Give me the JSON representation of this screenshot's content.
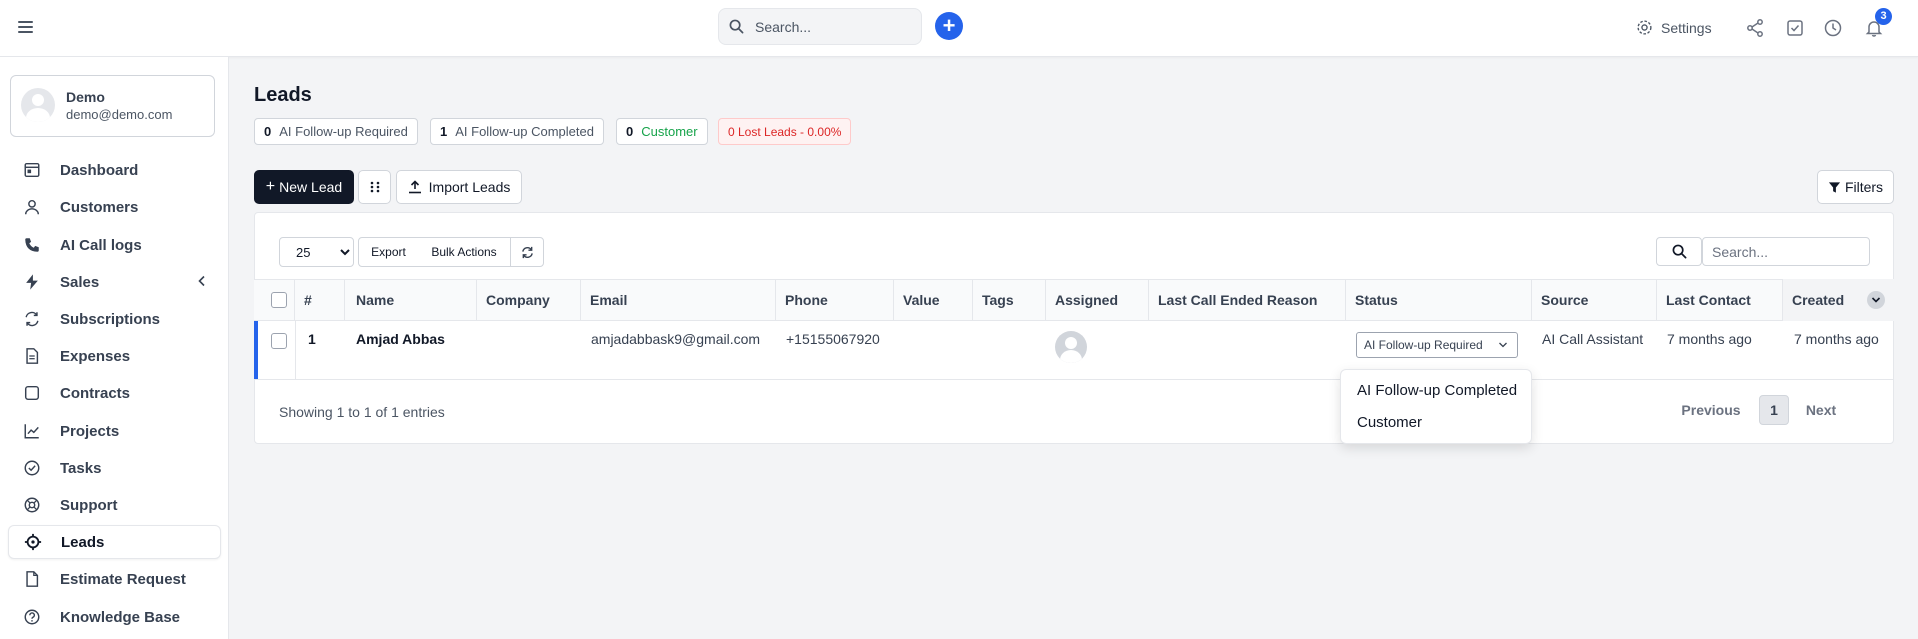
{
  "topbar": {
    "search_placeholder": "Search...",
    "settings_label": "Settings",
    "notifications_count": "3"
  },
  "profile": {
    "name": "Demo",
    "email": "demo@demo.com"
  },
  "sidebar": {
    "items": [
      {
        "label": "Dashboard",
        "icon": "dashboard-icon"
      },
      {
        "label": "Customers",
        "icon": "user-icon"
      },
      {
        "label": "AI Call logs",
        "icon": "phone-icon"
      },
      {
        "label": "Sales",
        "icon": "bolt-icon"
      },
      {
        "label": "Subscriptions",
        "icon": "refresh-icon"
      },
      {
        "label": "Expenses",
        "icon": "document-icon"
      },
      {
        "label": "Contracts",
        "icon": "square-icon"
      },
      {
        "label": "Projects",
        "icon": "chart-icon"
      },
      {
        "label": "Tasks",
        "icon": "check-circle-icon"
      },
      {
        "label": "Support",
        "icon": "lifebuoy-icon"
      },
      {
        "label": "Leads",
        "icon": "crosshair-icon"
      },
      {
        "label": "Estimate Request",
        "icon": "file-icon"
      },
      {
        "label": "Knowledge Base",
        "icon": "question-circle-icon"
      }
    ],
    "active": "Leads"
  },
  "page": {
    "title": "Leads",
    "chips": [
      {
        "count": "0",
        "label": "AI Follow-up Required"
      },
      {
        "count": "1",
        "label": "AI Follow-up Completed"
      },
      {
        "count": "0",
        "label": "Customer",
        "color": "#16a34a"
      }
    ],
    "lost_chip": "0 Lost Leads - 0.00%",
    "new_lead": "New Lead",
    "import_leads": "Import Leads",
    "filters": "Filters"
  },
  "table_controls": {
    "page_length": "25",
    "export": "Export",
    "bulk_actions": "Bulk Actions",
    "search_placeholder": "Search..."
  },
  "table": {
    "columns": [
      "#",
      "Name",
      "Company",
      "Email",
      "Phone",
      "Value",
      "Tags",
      "Assigned",
      "Last Call Ended Reason",
      "Status",
      "Source",
      "Last Contact",
      "Created"
    ],
    "rows": [
      {
        "id": "1",
        "name": "Amjad Abbas",
        "company": "",
        "email": "amjadabbask9@gmail.com",
        "phone": "+15155067920",
        "value": "",
        "tags": "",
        "status": "AI Follow-up Required",
        "source": "AI Call Assistant",
        "last_contact": "7 months ago",
        "created": "7 months ago"
      }
    ]
  },
  "status_dropdown": {
    "options": [
      "AI Follow-up Completed",
      "Customer"
    ]
  },
  "footer": {
    "showing": "Showing 1 to 1 of 1 entries",
    "previous": "Previous",
    "page": "1",
    "next": "Next"
  },
  "colors": {
    "accent": "#2563eb",
    "dark_button": "#111827",
    "lost": "#dc2626",
    "customer": "#16a34a"
  }
}
